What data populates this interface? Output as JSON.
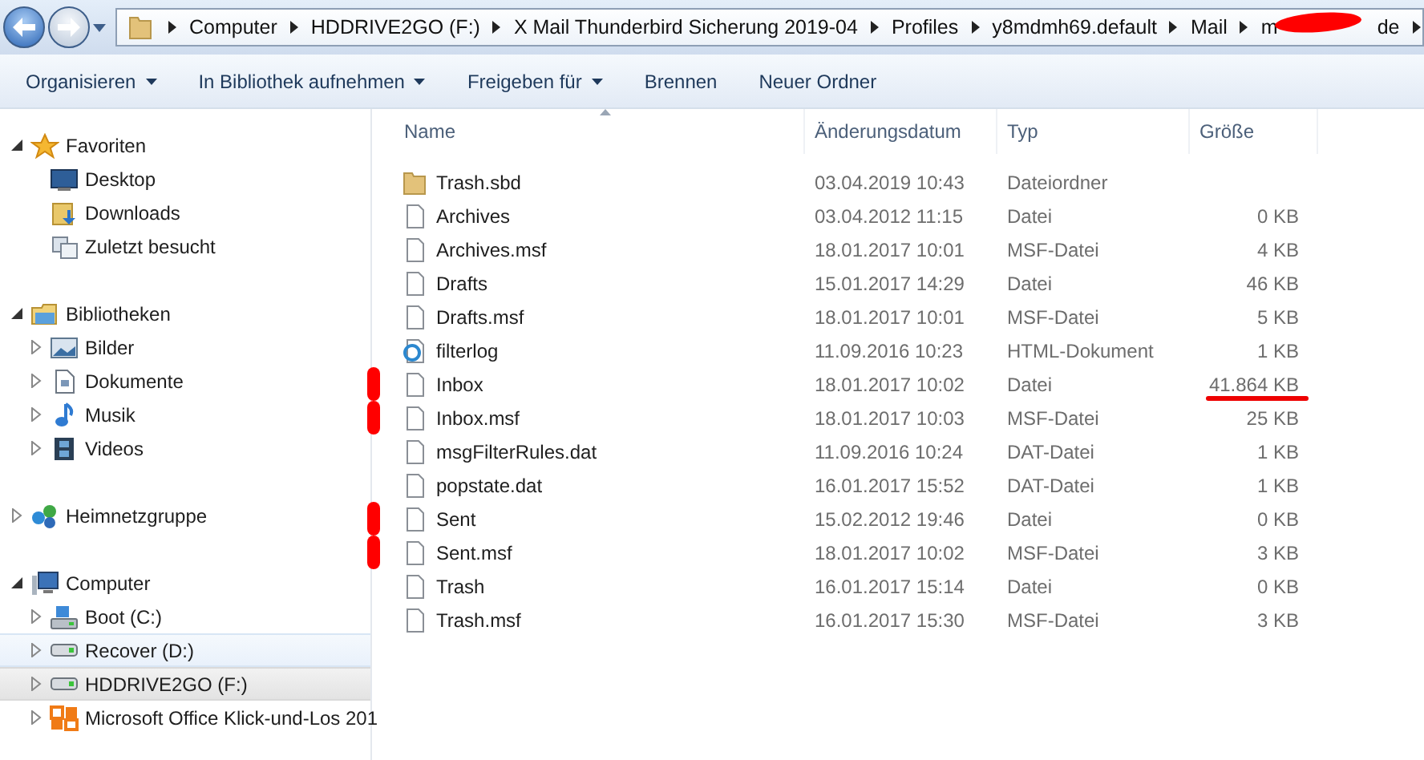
{
  "breadcrumbs": [
    {
      "label": "Computer"
    },
    {
      "label": "HDDRIVE2GO (F:)"
    },
    {
      "label": "X Mail Thunderbird Sicherung 2019-04"
    },
    {
      "label": "Profiles"
    },
    {
      "label": "y8mdmh69.default"
    },
    {
      "label": "Mail"
    },
    {
      "label_start": "m",
      "label_end": "de",
      "scribbled": true
    }
  ],
  "toolbar": [
    {
      "label": "Organisieren",
      "dropdown": true
    },
    {
      "label": "In Bibliothek aufnehmen",
      "dropdown": true
    },
    {
      "label": "Freigeben für",
      "dropdown": true
    },
    {
      "label": "Brennen",
      "dropdown": false
    },
    {
      "label": "Neuer Ordner",
      "dropdown": false
    }
  ],
  "sidebar": [
    {
      "label": "Favoriten",
      "kind": "star",
      "expanded": true,
      "children": [
        {
          "label": "Desktop",
          "kind": "desktop",
          "selected": false,
          "hovered": false
        },
        {
          "label": "Downloads",
          "kind": "downloads",
          "selected": false,
          "hovered": false
        },
        {
          "label": "Zuletzt besucht",
          "kind": "recent",
          "selected": false,
          "hovered": false
        }
      ]
    },
    {
      "label": "Bibliotheken",
      "kind": "library",
      "expanded": true,
      "children": [
        {
          "label": "Bilder",
          "kind": "pictures",
          "expanded": false,
          "selected": false,
          "hovered": false
        },
        {
          "label": "Dokumente",
          "kind": "documents",
          "expanded": false,
          "selected": false,
          "hovered": false
        },
        {
          "label": "Musik",
          "kind": "music",
          "expanded": false,
          "selected": false,
          "hovered": false
        },
        {
          "label": "Videos",
          "kind": "videos",
          "expanded": false,
          "selected": false,
          "hovered": false
        }
      ]
    },
    {
      "label": "Heimnetzgruppe",
      "kind": "network",
      "expanded": false
    },
    {
      "label": "Computer",
      "kind": "computer",
      "expanded": true,
      "children": [
        {
          "label": "Boot (C:)",
          "kind": "system-drive",
          "expanded": false,
          "selected": false,
          "hovered": false
        },
        {
          "label": "Recover (D:)",
          "kind": "drive",
          "expanded": false,
          "selected": false,
          "hovered": true
        },
        {
          "label": "HDDRIVE2GO (F:)",
          "kind": "drive",
          "expanded": false,
          "selected": true,
          "hovered": false
        },
        {
          "label": "Microsoft Office Klick-und-Los 201",
          "kind": "office",
          "expanded": false,
          "selected": false,
          "hovered": false
        }
      ]
    }
  ],
  "table": {
    "columns": [
      {
        "label": "Name",
        "sorted": true
      },
      {
        "label": "Änderungsdatum",
        "sorted": false
      },
      {
        "label": "Typ",
        "sorted": false
      },
      {
        "label": "Größe",
        "sorted": false
      }
    ],
    "rows": [
      {
        "name": "Trash.sbd",
        "kind": "folder",
        "date": "03.04.2019 10:43",
        "type": "Dateiordner",
        "size": "",
        "scribble": false,
        "size_underlined": false
      },
      {
        "name": "Archives",
        "kind": "file",
        "date": "03.04.2012 11:15",
        "type": "Datei",
        "size": "0 KB",
        "scribble": false,
        "size_underlined": false
      },
      {
        "name": "Archives.msf",
        "kind": "file",
        "date": "18.01.2017 10:01",
        "type": "MSF-Datei",
        "size": "4 KB",
        "scribble": false,
        "size_underlined": false
      },
      {
        "name": "Drafts",
        "kind": "file",
        "date": "15.01.2017 14:29",
        "type": "Datei",
        "size": "46 KB",
        "scribble": false,
        "size_underlined": false
      },
      {
        "name": "Drafts.msf",
        "kind": "file",
        "date": "18.01.2017 10:01",
        "type": "MSF-Datei",
        "size": "5 KB",
        "scribble": false,
        "size_underlined": false
      },
      {
        "name": "filterlog",
        "kind": "html",
        "date": "11.09.2016 10:23",
        "type": "HTML-Dokument",
        "size": "1 KB",
        "scribble": false,
        "size_underlined": false
      },
      {
        "name": "Inbox",
        "kind": "file",
        "date": "18.01.2017 10:02",
        "type": "Datei",
        "size": "41.864 KB",
        "scribble": true,
        "size_underlined": true
      },
      {
        "name": "Inbox.msf",
        "kind": "file",
        "date": "18.01.2017 10:03",
        "type": "MSF-Datei",
        "size": "25 KB",
        "scribble": true,
        "size_underlined": false
      },
      {
        "name": "msgFilterRules.dat",
        "kind": "file",
        "date": "11.09.2016 10:24",
        "type": "DAT-Datei",
        "size": "1 KB",
        "scribble": false,
        "size_underlined": false
      },
      {
        "name": "popstate.dat",
        "kind": "file",
        "date": "16.01.2017 15:52",
        "type": "DAT-Datei",
        "size": "1 KB",
        "scribble": false,
        "size_underlined": false
      },
      {
        "name": "Sent",
        "kind": "file",
        "date": "15.02.2012 19:46",
        "type": "Datei",
        "size": "0 KB",
        "scribble": true,
        "size_underlined": false
      },
      {
        "name": "Sent.msf",
        "kind": "file",
        "date": "18.01.2017 10:02",
        "type": "MSF-Datei",
        "size": "3 KB",
        "scribble": true,
        "size_underlined": false
      },
      {
        "name": "Trash",
        "kind": "file",
        "date": "16.01.2017 15:14",
        "type": "Datei",
        "size": "0 KB",
        "scribble": false,
        "size_underlined": false
      },
      {
        "name": "Trash.msf",
        "kind": "file",
        "date": "16.01.2017 15:30",
        "type": "MSF-Datei",
        "size": "3 KB",
        "scribble": false,
        "size_underlined": false
      }
    ]
  }
}
